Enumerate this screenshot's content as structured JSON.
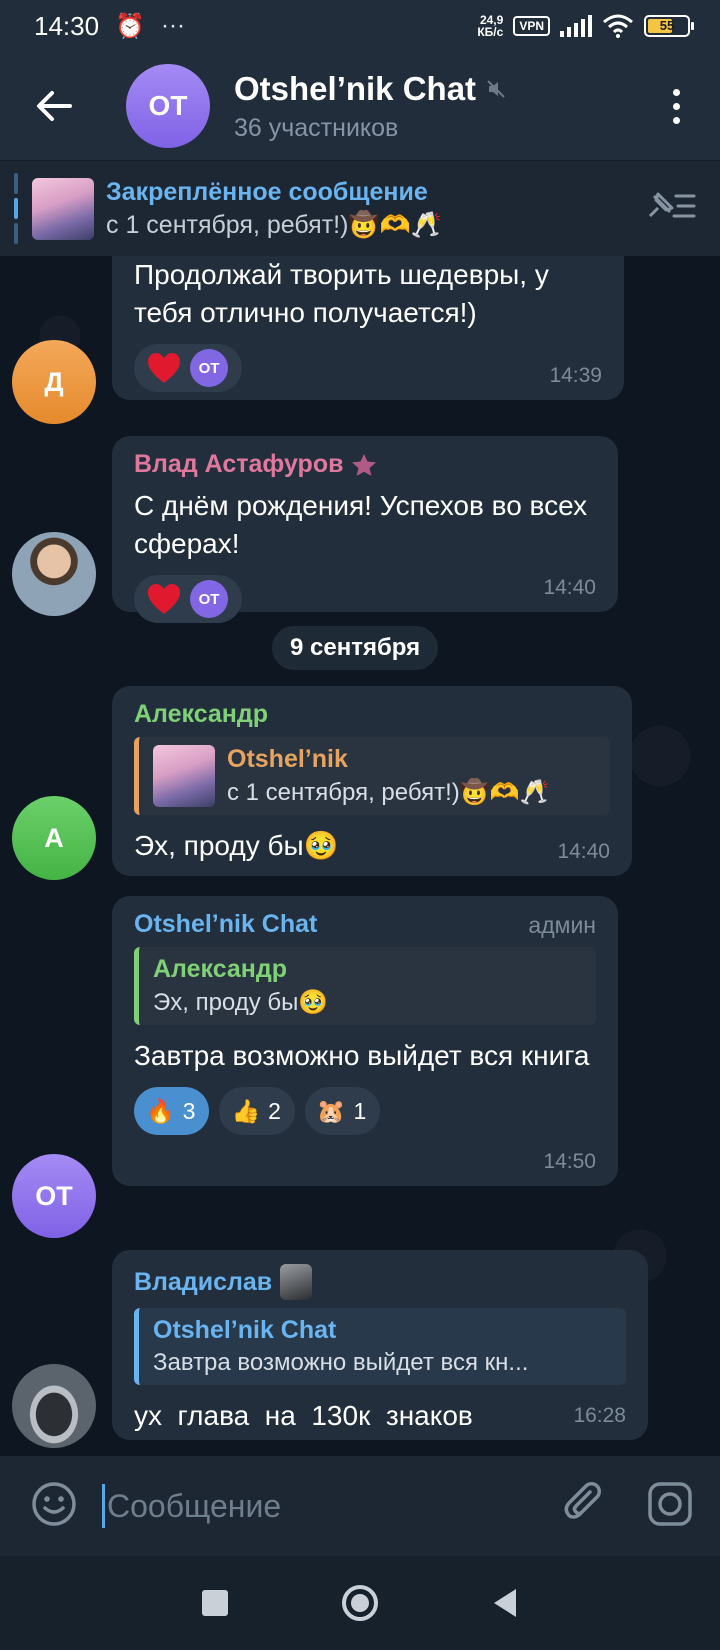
{
  "status_bar": {
    "time": "14:30",
    "alarm_icon": "alarm-icon",
    "more": "···",
    "net_speed_value": "24,9",
    "net_speed_unit": "КБ/с",
    "vpn": "VPN",
    "battery": "55"
  },
  "header": {
    "avatar_initials": "OT",
    "title": "Otshel’nik Chat",
    "subtitle": "36 участников"
  },
  "pinned": {
    "title": "Закреплённое сообщение",
    "text": "с 1 сентября, ребят!)🤠🫶🥂"
  },
  "messages": [
    {
      "avatar": "Д",
      "text": "Продолжай творить шедевры, у тебя отлично получается!)",
      "reaction_avatar": "OT",
      "time": "14:39"
    },
    {
      "sender": "Влад Астафуров",
      "text": "С днём рождения! Успехов во всех сферах!",
      "reaction_avatar": "OT",
      "time": "14:40"
    },
    {
      "sender": "Александр",
      "avatar": "А",
      "reply_name": "Otshel’nik",
      "reply_text": "с 1 сентября, ребят!)🤠🫶🥂",
      "text": "Эх, проду бы🥹",
      "time": "14:40"
    },
    {
      "sender": "Otshel’nik Chat",
      "badge": "админ",
      "avatar": "OT",
      "reply_name": "Александр",
      "reply_text": "Эх, проду бы🥹",
      "text": "Завтра возможно выйдет вся книга",
      "reactions": [
        {
          "emoji": "🔥",
          "count": "3"
        },
        {
          "emoji": "👍",
          "count": "2"
        },
        {
          "emoji": "🐹",
          "count": "1"
        }
      ],
      "time": "14:50"
    },
    {
      "sender": "Владислав",
      "reply_name": "Otshel’nik Chat",
      "reply_text": "Завтра возможно выйдет вся кн...",
      "text": "ух  глава  на  130к  знаков",
      "time": "16:28"
    }
  ],
  "date_separator": "9 сентября",
  "input": {
    "placeholder": "Сообщение"
  },
  "colors": {
    "accent": "#6ab4f0",
    "bubble": "#222e3b",
    "background": "#0e1621",
    "vlad_name": "#e0789e",
    "alexandr_name": "#7fd076",
    "orange_reply": "#e7a45f"
  }
}
